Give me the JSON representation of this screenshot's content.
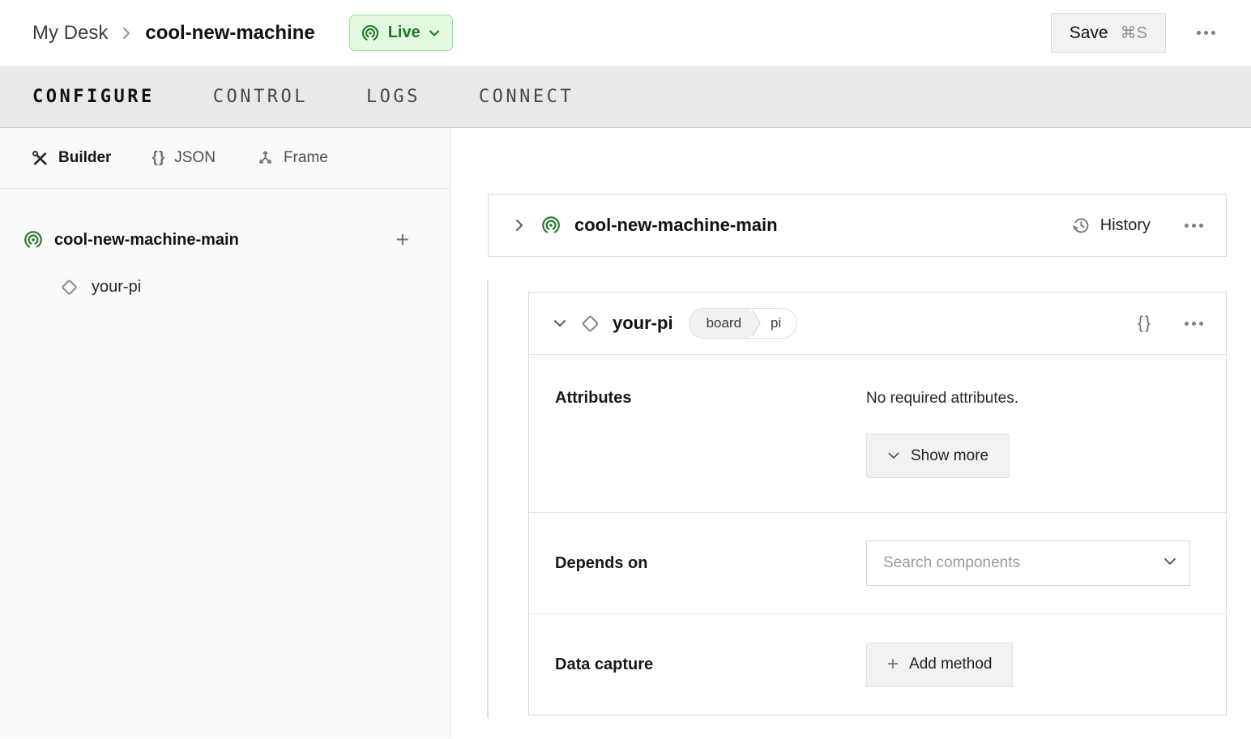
{
  "topbar": {
    "breadcrumb": {
      "parent": "My Desk",
      "current": "cool-new-machine"
    },
    "live": {
      "label": "Live"
    },
    "save": {
      "label": "Save",
      "shortcut": "⌘S"
    }
  },
  "tabs": [
    {
      "label": "CONFIGURE",
      "active": true
    },
    {
      "label": "CONTROL",
      "active": false
    },
    {
      "label": "LOGS",
      "active": false
    },
    {
      "label": "CONNECT",
      "active": false
    }
  ],
  "sidebar": {
    "modes": [
      {
        "label": "Builder",
        "icon": "tools-icon",
        "active": true
      },
      {
        "label": "JSON",
        "icon": "braces-icon",
        "active": false
      },
      {
        "label": "Frame",
        "icon": "frame-axes-icon",
        "active": false
      }
    ],
    "tree": {
      "machine": {
        "name": "cool-new-machine-main",
        "icon": "machine-part-icon"
      },
      "component": {
        "name": "your-pi",
        "icon": "component-diamond-icon"
      }
    }
  },
  "main": {
    "machine_card": {
      "title": "cool-new-machine-main",
      "history_label": "History"
    },
    "component_card": {
      "title": "your-pi",
      "tags": {
        "type": "board",
        "model": "pi"
      },
      "attributes": {
        "label": "Attributes",
        "empty_text": "No required attributes.",
        "show_more_label": "Show more"
      },
      "depends_on": {
        "label": "Depends on",
        "search_placeholder": "Search components"
      },
      "data_capture": {
        "label": "Data capture",
        "add_method_label": "Add method"
      }
    }
  },
  "icons": {
    "plus_glyph": "+",
    "braces_glyph": "{}"
  },
  "colors": {
    "live_green_text": "#1e7b23",
    "live_green_bg": "#e2f8e1",
    "live_green_border": "#a3dba4",
    "part_icon_green": "#2e7d32",
    "tabbar_bg": "#e9e9ec",
    "sidebar_bg": "#fafafa",
    "card_border": "#d9d9de",
    "button_bg": "#f2f2f3"
  }
}
